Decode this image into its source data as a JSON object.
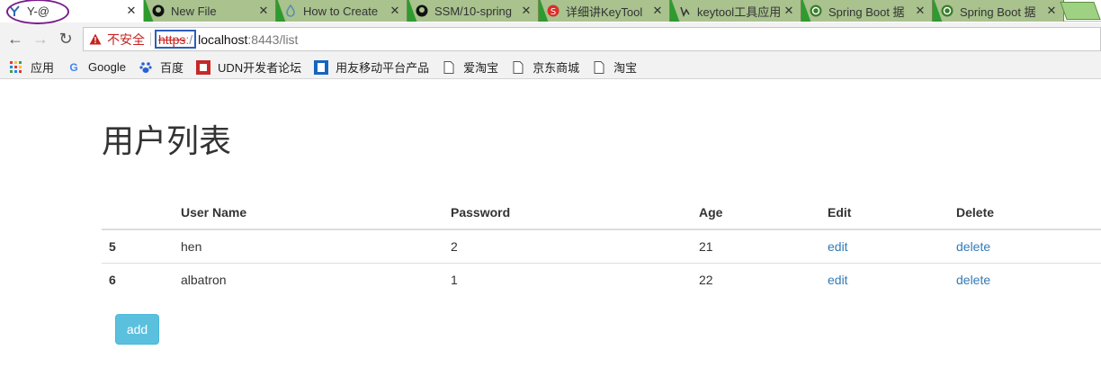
{
  "tabs": [
    {
      "title": "Y-@",
      "icon": "yammer-icon",
      "active": true
    },
    {
      "title": "New File",
      "icon": "github-icon"
    },
    {
      "title": "How to Create",
      "icon": "drop-icon"
    },
    {
      "title": "SSM/10-spring",
      "icon": "github-icon"
    },
    {
      "title": "详细讲KeyTool",
      "icon": "csdn-icon"
    },
    {
      "title": "keytool工具应用",
      "icon": "paw-icon"
    },
    {
      "title": "Spring Boot 据",
      "icon": "spring-icon"
    },
    {
      "title": "Spring Boot 据",
      "icon": "spring-icon"
    }
  ],
  "address": {
    "insecure_label": "不安全",
    "scheme": "https",
    "scheme_sep": ":/",
    "host": "localhost",
    "rest": ":8443/list"
  },
  "bookmarks": [
    {
      "label": "应用",
      "icon": "apps-grid-icon"
    },
    {
      "label": "Google",
      "icon": "google-icon"
    },
    {
      "label": "百度",
      "icon": "baidu-paw-icon"
    },
    {
      "label": "UDN开发者论坛",
      "icon": "udn-icon"
    },
    {
      "label": "用友移动平台产品",
      "icon": "yonyou-icon"
    },
    {
      "label": "爱淘宝",
      "icon": "page-icon"
    },
    {
      "label": "京东商城",
      "icon": "page-icon"
    },
    {
      "label": "淘宝",
      "icon": "page-icon"
    }
  ],
  "page": {
    "title": "用户列表",
    "columns": [
      "",
      "User Name",
      "Password",
      "Age",
      "Edit",
      "Delete"
    ],
    "rows": [
      {
        "id": "5",
        "name": "hen",
        "password": "2",
        "age": "21",
        "edit": "edit",
        "delete": "delete"
      },
      {
        "id": "6",
        "name": "albatron",
        "password": "1",
        "age": "22",
        "edit": "edit",
        "delete": "delete"
      }
    ],
    "add_label": "add"
  },
  "colors": {
    "tab_inactive": "#a9c28e",
    "link": "#337ab7",
    "add_button": "#5bc0de",
    "insecure_red": "#c5221f"
  }
}
